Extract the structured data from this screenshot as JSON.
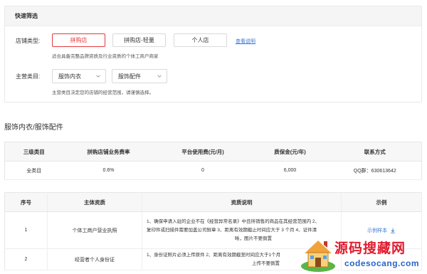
{
  "filter": {
    "title": "快速筛选",
    "store_type_label": "店铺类型:",
    "store_types": [
      "拼购店",
      "拼购店-轻量",
      "个人店"
    ],
    "view_link": "查看说明",
    "store_hint": "适合具备完整品牌资质及行业资质的个体工商户商家",
    "category_label": "主营类目:",
    "category1": "服饰内衣",
    "category2": "服饰配件",
    "category_hint": "主营类目决定您的店铺的经营范围，请谨慎选择。"
  },
  "section_title": "服饰内衣/服饰配件",
  "fee_table": {
    "headers": [
      "三级类目",
      "拼购店铺业务费率",
      "平台使用费(元/月)",
      "质保金(元/年)",
      "联系方式"
    ],
    "row": [
      "全类目",
      "0.6%",
      "0",
      "6,000",
      "QQ群：630613642"
    ]
  },
  "qual_table": {
    "headers": [
      "序号",
      "主体资质",
      "资质说明",
      "示例"
    ],
    "rows": [
      {
        "no": "1",
        "subject": "个体工商户营业执照",
        "desc1": "1、确保申请入驻的企业不在《经营异常名录》中且所销售的商品在其经营范围内 2、",
        "desc2": "复印件或扫描件需要加盖公司鲜章 3、距离有效期截止时间应大于 3 个月 4、证件清",
        "desc3": "晰，图片不要倒置",
        "example": "示例样本"
      },
      {
        "no": "2",
        "subject": "经营者个人身份证",
        "desc1": "1、身份证照片必须上传原件 2、距离有效期截至时间应大于1个月",
        "desc2": "上传不要倒置",
        "example": ""
      }
    ]
  },
  "watermark": {
    "main": "源码搜藏网",
    "sub": "codesocang.com"
  },
  "colors": {
    "accent_red": "#e4393c",
    "link_blue": "#3a7ad5"
  }
}
